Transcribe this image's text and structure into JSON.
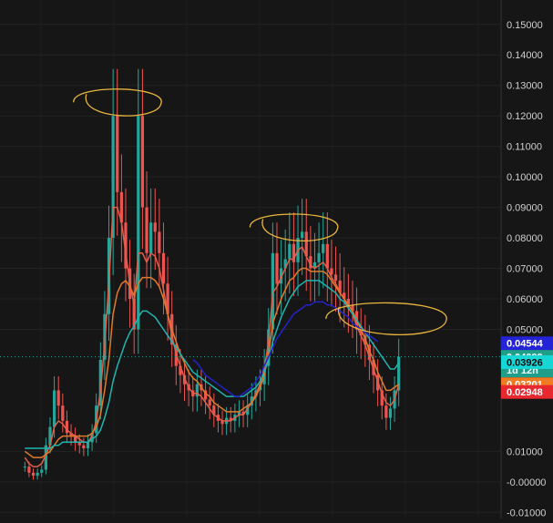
{
  "chart_data": {
    "type": "candlestick",
    "title": "",
    "xlabel": "",
    "ylabel": "",
    "ylim": [
      -0.012,
      0.158
    ],
    "grid": true,
    "y_ticks": [
      {
        "value": 0.15,
        "label": "0.15000"
      },
      {
        "value": 0.14,
        "label": "0.14000"
      },
      {
        "value": 0.13,
        "label": "0.13000"
      },
      {
        "value": 0.12,
        "label": "0.12000"
      },
      {
        "value": 0.11,
        "label": "0.11000"
      },
      {
        "value": 0.1,
        "label": "0.10000"
      },
      {
        "value": 0.09,
        "label": "0.09000"
      },
      {
        "value": 0.08,
        "label": "0.08000"
      },
      {
        "value": 0.07,
        "label": "0.07000"
      },
      {
        "value": 0.06,
        "label": "0.06000"
      },
      {
        "value": 0.05,
        "label": "0.05000"
      },
      {
        "value": 0.01,
        "label": "0.01000"
      },
      {
        "value": 0.0,
        "label": "-0.00000"
      },
      {
        "value": -0.01,
        "label": "-0.01000"
      }
    ],
    "price_close": [
      0.005,
      0.003,
      0.002,
      0.003,
      0.004,
      0.012,
      0.018,
      0.03,
      0.025,
      0.02,
      0.016,
      0.015,
      0.013,
      0.012,
      0.011,
      0.013,
      0.016,
      0.025,
      0.04,
      0.055,
      0.08,
      0.12,
      0.095,
      0.085,
      0.07,
      0.06,
      0.05,
      0.12,
      0.09,
      0.075,
      0.085,
      0.082,
      0.075,
      0.065,
      0.055,
      0.045,
      0.038,
      0.035,
      0.032,
      0.03,
      0.028,
      0.032,
      0.03,
      0.027,
      0.025,
      0.022,
      0.02,
      0.019,
      0.021,
      0.02,
      0.022,
      0.023,
      0.022,
      0.025,
      0.028,
      0.03,
      0.032,
      0.038,
      0.05,
      0.075,
      0.065,
      0.07,
      0.073,
      0.078,
      0.072,
      0.08,
      0.082,
      0.074,
      0.07,
      0.072,
      0.075,
      0.078,
      0.07,
      0.068,
      0.066,
      0.062,
      0.06,
      0.058,
      0.056,
      0.05,
      0.048,
      0.045,
      0.04,
      0.035,
      0.03,
      0.025,
      0.021,
      0.024,
      0.03,
      0.041
    ],
    "moving_averages": [
      {
        "color": "#e0604a",
        "values": [
          0.008,
          0.006,
          0.005,
          0.005,
          0.006,
          0.009,
          0.012,
          0.018,
          0.02,
          0.019,
          0.017,
          0.016,
          0.015,
          0.014,
          0.013,
          0.013,
          0.015,
          0.02,
          0.03,
          0.045,
          0.065,
          0.09,
          0.09,
          0.085,
          0.075,
          0.065,
          0.058,
          0.075,
          0.075,
          0.072,
          0.075,
          0.074,
          0.07,
          0.063,
          0.055,
          0.048,
          0.042,
          0.038,
          0.034,
          0.031,
          0.029,
          0.029,
          0.028,
          0.026,
          0.024,
          0.022,
          0.021,
          0.02,
          0.02,
          0.02,
          0.021,
          0.022,
          0.022,
          0.024,
          0.026,
          0.029,
          0.032,
          0.037,
          0.046,
          0.062,
          0.064,
          0.067,
          0.07,
          0.073,
          0.073,
          0.076,
          0.077,
          0.074,
          0.071,
          0.07,
          0.071,
          0.072,
          0.07,
          0.067,
          0.065,
          0.062,
          0.06,
          0.057,
          0.055,
          0.051,
          0.048,
          0.045,
          0.041,
          0.037,
          0.033,
          0.029,
          0.026,
          0.025,
          0.027,
          0.032
        ]
      },
      {
        "color": "#e07a2a",
        "values": [
          0.01,
          0.009,
          0.008,
          0.008,
          0.008,
          0.009,
          0.01,
          0.012,
          0.014,
          0.015,
          0.015,
          0.015,
          0.015,
          0.015,
          0.015,
          0.015,
          0.016,
          0.018,
          0.022,
          0.03,
          0.04,
          0.055,
          0.062,
          0.065,
          0.066,
          0.064,
          0.061,
          0.065,
          0.067,
          0.067,
          0.067,
          0.066,
          0.064,
          0.06,
          0.055,
          0.05,
          0.046,
          0.042,
          0.039,
          0.036,
          0.034,
          0.033,
          0.031,
          0.029,
          0.028,
          0.026,
          0.025,
          0.024,
          0.023,
          0.023,
          0.023,
          0.023,
          0.024,
          0.025,
          0.026,
          0.028,
          0.031,
          0.035,
          0.042,
          0.052,
          0.056,
          0.06,
          0.063,
          0.066,
          0.067,
          0.069,
          0.07,
          0.07,
          0.069,
          0.069,
          0.069,
          0.069,
          0.068,
          0.066,
          0.064,
          0.062,
          0.06,
          0.058,
          0.056,
          0.053,
          0.05,
          0.047,
          0.043,
          0.04,
          0.036,
          0.033,
          0.03,
          0.03,
          0.031,
          0.032
        ]
      },
      {
        "color": "#1fb5b0",
        "values": [
          0.011,
          0.011,
          0.011,
          0.011,
          0.011,
          0.011,
          0.011,
          0.012,
          0.012,
          0.013,
          0.013,
          0.013,
          0.013,
          0.013,
          0.013,
          0.013,
          0.014,
          0.015,
          0.017,
          0.021,
          0.026,
          0.033,
          0.038,
          0.042,
          0.046,
          0.049,
          0.051,
          0.054,
          0.056,
          0.056,
          0.055,
          0.054,
          0.052,
          0.05,
          0.048,
          0.046,
          0.044,
          0.042,
          0.04,
          0.038,
          0.036,
          0.035,
          0.034,
          0.033,
          0.032,
          0.031,
          0.03,
          0.029,
          0.028,
          0.028,
          0.028,
          0.028,
          0.028,
          0.029,
          0.03,
          0.031,
          0.033,
          0.036,
          0.04,
          0.046,
          0.05,
          0.054,
          0.057,
          0.06,
          0.062,
          0.064,
          0.065,
          0.066,
          0.066,
          0.066,
          0.066,
          0.065,
          0.064,
          0.063,
          0.062,
          0.06,
          0.059,
          0.057,
          0.055,
          0.053,
          0.051,
          0.049,
          0.047,
          0.045,
          0.043,
          0.041,
          0.039,
          0.037,
          0.037,
          0.039
        ]
      },
      {
        "color": "#2323c8",
        "values": [
          null,
          null,
          null,
          null,
          null,
          null,
          null,
          null,
          null,
          null,
          null,
          null,
          null,
          null,
          null,
          null,
          null,
          null,
          null,
          null,
          null,
          null,
          null,
          null,
          null,
          null,
          null,
          null,
          null,
          null,
          null,
          null,
          null,
          null,
          null,
          null,
          null,
          null,
          null,
          null,
          0.04,
          0.039,
          0.037,
          0.035,
          0.034,
          0.033,
          0.032,
          0.031,
          0.03,
          0.029,
          0.028,
          0.028,
          0.029,
          0.03,
          0.031,
          0.033,
          0.035,
          0.038,
          0.041,
          0.044,
          0.047,
          0.049,
          0.051,
          0.053,
          0.055,
          0.056,
          0.057,
          0.058,
          0.058,
          0.059,
          0.059,
          0.059,
          0.058,
          0.058,
          0.057,
          0.056,
          0.055,
          0.054,
          0.052,
          0.051,
          0.05,
          0.049,
          0.048,
          0.047,
          0.046,
          null,
          null,
          null,
          null,
          null
        ]
      }
    ],
    "current_line": {
      "value": 0.04099,
      "color": "#26a69a"
    },
    "price_badges": [
      {
        "value": 0.04544,
        "label": "0.04544",
        "bg": "#2424d6",
        "fg": "#ffffff",
        "sub": ""
      },
      {
        "value": 0.04099,
        "label": "0.04099",
        "bg": "#1f9e8a",
        "fg": "#ffffff",
        "sub": "1d 12h"
      },
      {
        "value": 0.03926,
        "label": "0.03926",
        "bg": "#17d6d6",
        "fg": "#0d0d0d",
        "sub": ""
      },
      {
        "value": 0.03201,
        "label": "0.03201",
        "bg": "#ef7b22",
        "fg": "#ffffff",
        "sub": ""
      },
      {
        "value": 0.02948,
        "label": "0.02948",
        "bg": "#e8272e",
        "fg": "#ffffff",
        "sub": ""
      }
    ],
    "annotations": [
      {
        "type": "hand-drawn-ellipse",
        "color": "#e8b640",
        "center_index": 22,
        "center_value": 0.124
      },
      {
        "type": "hand-drawn-ellipse",
        "color": "#e8b640",
        "center_index": 64,
        "center_value": 0.083
      },
      {
        "type": "hand-drawn-ellipse",
        "color": "#e8b640",
        "center_index": 86,
        "center_value": 0.053
      }
    ]
  }
}
